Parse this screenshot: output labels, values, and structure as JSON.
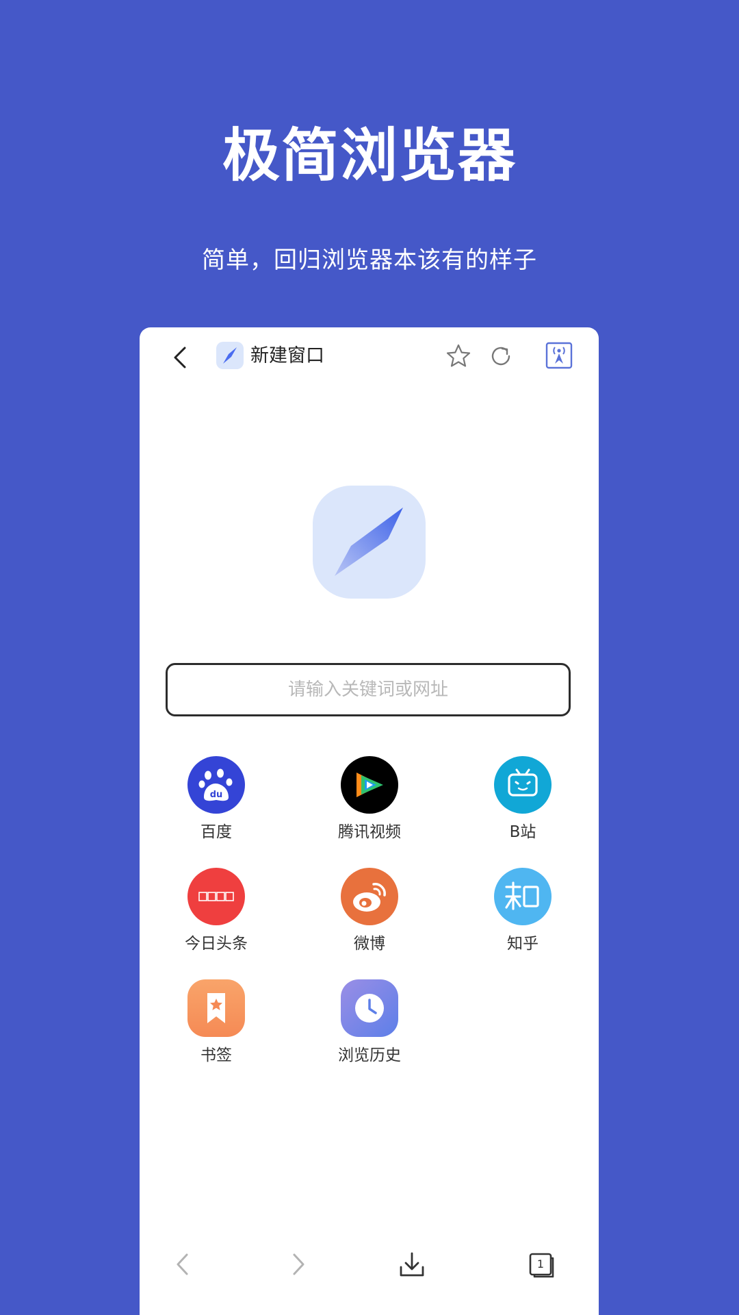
{
  "promo": {
    "title": "极简浏览器",
    "subtitle": "简单，回归浏览器本该有的样子"
  },
  "topbar": {
    "tab_title": "新建窗口",
    "icons": [
      "back-icon",
      "compass-icon",
      "star-icon",
      "reload-icon",
      "sniff-icon"
    ]
  },
  "search": {
    "placeholder": "请输入关键词或网址"
  },
  "shortcuts": [
    {
      "label": "百度",
      "icon": "baidu-icon",
      "color": "#3444d6"
    },
    {
      "label": "腾讯视频",
      "icon": "tencent-video-icon",
      "color": "#000000"
    },
    {
      "label": "B站",
      "icon": "bilibili-icon",
      "color": "#11a7d6"
    },
    {
      "label": "今日头条",
      "icon": "toutiao-icon",
      "color": "#ef3f3f"
    },
    {
      "label": "微博",
      "icon": "weibo-icon",
      "color": "#e8713d"
    },
    {
      "label": "知乎",
      "icon": "zhihu-icon",
      "color": "#4fb6f1"
    },
    {
      "label": "书签",
      "icon": "bookmark-icon",
      "color": "#f7985a"
    },
    {
      "label": "浏览历史",
      "icon": "history-icon",
      "color": "#6f8ae6"
    }
  ],
  "toolbar": {
    "tab_count": "1",
    "icons": [
      "back-arrow-icon",
      "forward-arrow-icon",
      "download-icon",
      "tabs-icon"
    ]
  },
  "colors": {
    "background": "#4558c8",
    "accent": "#4a6cf0"
  }
}
